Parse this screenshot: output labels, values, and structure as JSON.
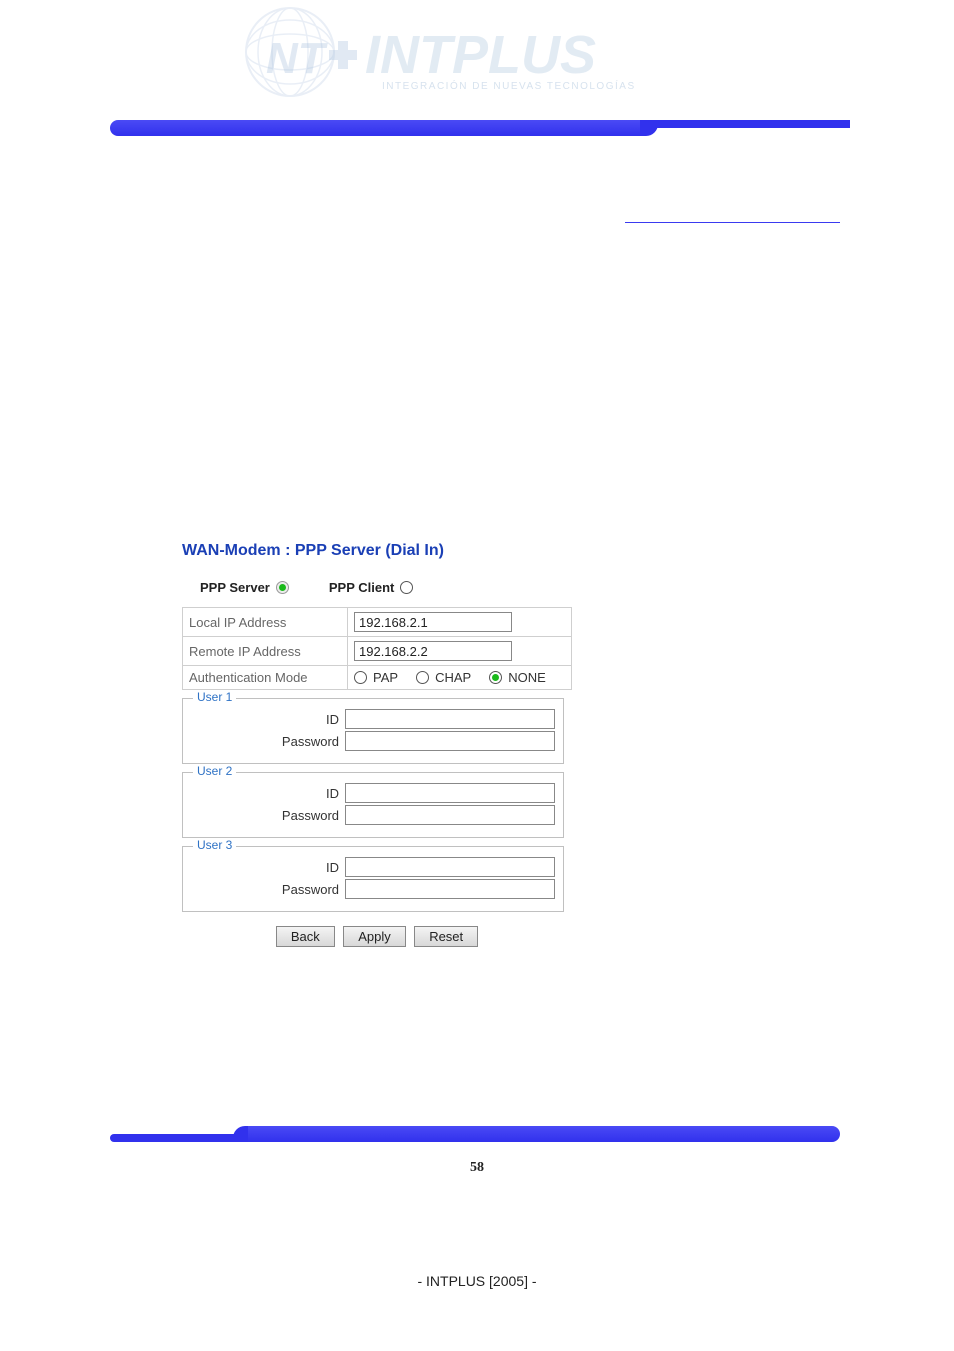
{
  "logo": {
    "brand": "INTPLUS",
    "tagline": "INTEGRACIÓN DE NUEVAS TECNOLOGÍAS"
  },
  "panel": {
    "title": "WAN-Modem : PPP Server (Dial In)",
    "modes": {
      "server_label": "PPP Server",
      "client_label": "PPP Client",
      "server_selected": true,
      "client_selected": false
    },
    "rows": {
      "local_ip_label": "Local IP Address",
      "local_ip_value": "192.168.2.1",
      "remote_ip_label": "Remote IP Address",
      "remote_ip_value": "192.168.2.2",
      "auth_label": "Authentication Mode",
      "auth_options": {
        "pap": "PAP",
        "chap": "CHAP",
        "none": "NONE"
      },
      "auth_selected": "none"
    },
    "users": [
      {
        "legend": "User 1",
        "id_label": "ID",
        "pw_label": "Password",
        "id_value": "",
        "pw_value": ""
      },
      {
        "legend": "User 2",
        "id_label": "ID",
        "pw_label": "Password",
        "id_value": "",
        "pw_value": ""
      },
      {
        "legend": "User 3",
        "id_label": "ID",
        "pw_label": "Password",
        "id_value": "",
        "pw_value": ""
      }
    ],
    "buttons": {
      "back": "Back",
      "apply": "Apply",
      "reset": "Reset"
    }
  },
  "page_number": "58",
  "footer": "- INTPLUS [2005] -"
}
